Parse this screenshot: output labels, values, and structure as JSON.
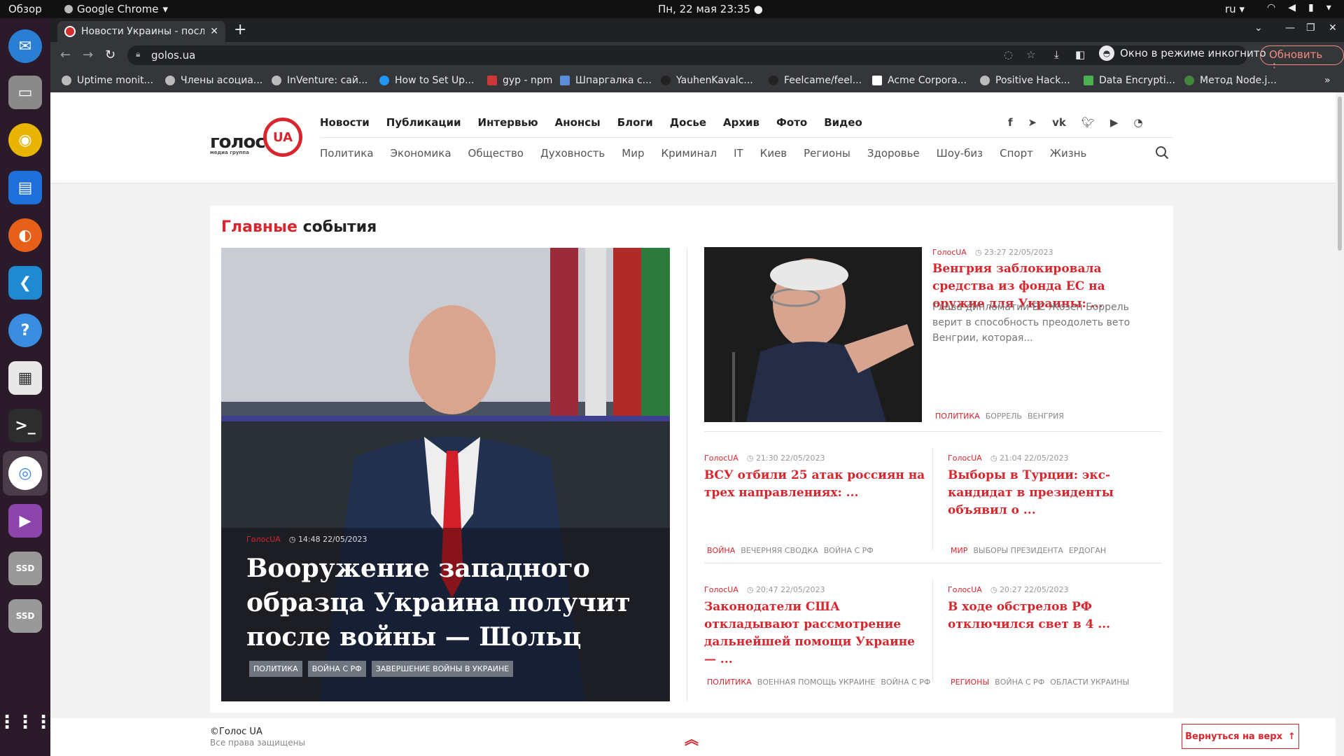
{
  "system": {
    "overview": "Обзор",
    "app_name": "Google Chrome",
    "clock": "Пн, 22 мая  23:35",
    "lang": "ru"
  },
  "browser": {
    "tab_title": "Новости Украины - после",
    "url": "golos.ua",
    "incognito_label": "Окно в режиме инкогнито",
    "update_label": "Обновить",
    "bookmarks": [
      "Uptime monit...",
      "Члены асоциа...",
      "InVenture: сай...",
      "How to Set Up...",
      "gyp - npm",
      "Шпаргалка с...",
      "YauhenKavalc...",
      "Feelcame/feel...",
      "Acme Corpora...",
      "Positive Hack...",
      "Data Encrypti...",
      "Метод Node.j..."
    ]
  },
  "site": {
    "logo_word": "голос",
    "logo_ua": "UA",
    "logo_sub": "медиа группа",
    "main_nav": [
      "Новости",
      "Публикации",
      "Интервью",
      "Анонсы",
      "Блоги",
      "Досье",
      "Архив",
      "Фото",
      "Видео"
    ],
    "sub_nav": [
      "Политика",
      "Экономика",
      "Общество",
      "Духовность",
      "Мир",
      "Криминал",
      "IT",
      "Киев",
      "Регионы",
      "Здоровье",
      "Шоу-биз",
      "Спорт",
      "Жизнь"
    ]
  },
  "section": {
    "title_red": "Главные",
    "title_rest": " события"
  },
  "hero": {
    "source": "ГолосUA",
    "time": "14:48 22/05/2023",
    "title": "Вооружение западного образца Украина получит после войны — Шольц",
    "tags": [
      "ПОЛИТИКА",
      "ВОЙНА С РФ",
      "ЗАВЕРШЕНИЕ ВОЙНЫ В УКРАИНЕ"
    ]
  },
  "featured": {
    "source": "ГолосUA",
    "time": "23:27 22/05/2023",
    "title": "Венгрия заблокировала средства из фонда ЕС на оружие для Украины: ...",
    "lead": "Глава дипломатии ЕС Жозеп Боррель верит в способность преодолеть вето Венгрии, которая...",
    "tags": [
      "ПОЛИТИКА",
      "БОРРЕЛЬ",
      "ВЕНГРИЯ"
    ]
  },
  "cards": [
    {
      "source": "ГолосUA",
      "time": "21:30 22/05/2023",
      "title": "ВСУ отбили 25 атак россиян на трех направлениях: ...",
      "tags": [
        "ВОЙНА",
        "ВЕЧЕРНЯЯ СВОДКА",
        "ВОЙНА С РФ"
      ]
    },
    {
      "source": "ГолосUA",
      "time": "21:04 22/05/2023",
      "title": "Выборы в Турции: экс-кандидат в президенты объявил о ...",
      "tags": [
        "МИР",
        "ВЫБОРЫ ПРЕЗИДЕНТА",
        "ЕРДОГАН"
      ]
    },
    {
      "source": "ГолосUA",
      "time": "20:47 22/05/2023",
      "title": "Законодатели США откладывают рассмотрение дальнейшей помощи Украине — ...",
      "tags": [
        "ПОЛИТИКА",
        "ВОЕННАЯ ПОМОЩЬ УКРАИНЕ",
        "ВОЙНА С РФ"
      ]
    },
    {
      "source": "ГолосUA",
      "time": "20:27 22/05/2023",
      "title": "В ходе обстрелов РФ отключился свет в 4 ...",
      "tags": [
        "РЕГИОНЫ",
        "ВОЙНА С РФ",
        "ОБЛАСТИ УКРАИНЫ"
      ]
    }
  ],
  "footer": {
    "copyright": "©Голос UA",
    "rights": "Все права защищены",
    "to_top": "Вернуться на верх"
  }
}
